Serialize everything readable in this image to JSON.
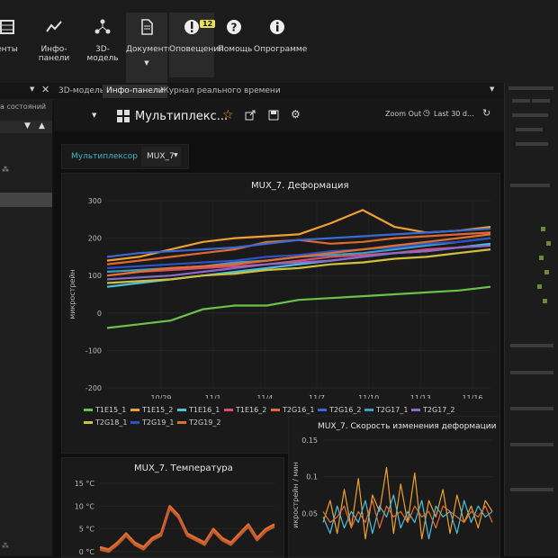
{
  "toolbar": {
    "buttons": [
      {
        "label": "енты",
        "icon": "grid-icon"
      },
      {
        "label": "Инфо-панели",
        "icon": "line-chart-icon"
      },
      {
        "label": "3D-модель",
        "icon": "network-icon"
      },
      {
        "label": "Документы",
        "icon": "document-icon"
      },
      {
        "label": "Оповещения",
        "icon": "alert-icon",
        "badge": "12"
      },
      {
        "label": "Помощь",
        "icon": "help-icon"
      },
      {
        "label": "Опрограмме",
        "icon": "info-icon"
      }
    ]
  },
  "tabs": {
    "items": [
      "3D-модель",
      "Инфо-панели",
      "Журнал реального времени"
    ],
    "active_index": 1
  },
  "left_panel": {
    "title": "а состояний"
  },
  "header": {
    "title": "Мультиплекс...",
    "zoom_out": "Zoom Out",
    "last": "Last 30 d..."
  },
  "filters": {
    "label": "Мультиплексор",
    "value": "MUX_7"
  },
  "colors": {
    "accent": "#3db7c4",
    "star": "#e8a020",
    "background": "#121212"
  },
  "chart_data": [
    {
      "type": "line",
      "title": "MUX_7. Деформация",
      "ylabel": "микрострейн",
      "ylim": [
        -200,
        300
      ],
      "yticks": [
        -200,
        -100,
        0,
        100,
        200,
        300
      ],
      "categories": [
        "10/29",
        "11/1",
        "11/4",
        "11/7",
        "11/10",
        "11/13",
        "11/16"
      ],
      "x": [
        0,
        2,
        4,
        6,
        8,
        10,
        12,
        14,
        16,
        18,
        20,
        22,
        24
      ],
      "series": [
        {
          "name": "T1E15_1",
          "color": "#6ac24a",
          "values": [
            -40,
            -30,
            -20,
            10,
            20,
            20,
            35,
            40,
            45,
            50,
            55,
            60,
            70
          ]
        },
        {
          "name": "T1E15_2",
          "color": "#f0a030",
          "values": [
            140,
            150,
            170,
            190,
            200,
            205,
            210,
            240,
            275,
            230,
            215,
            220,
            230
          ]
        },
        {
          "name": "T1E16_1",
          "color": "#4ac0e0",
          "values": [
            70,
            80,
            90,
            100,
            110,
            120,
            130,
            140,
            150,
            160,
            165,
            175,
            185
          ]
        },
        {
          "name": "T1E16_2",
          "color": "#e04a6a",
          "values": [
            100,
            110,
            115,
            120,
            125,
            130,
            140,
            150,
            155,
            160,
            170,
            175,
            180
          ]
        },
        {
          "name": "T2G16_1",
          "color": "#e06a30",
          "values": [
            130,
            140,
            150,
            160,
            170,
            190,
            195,
            185,
            190,
            200,
            205,
            210,
            215
          ]
        },
        {
          "name": "T2G16_2",
          "color": "#3a6ad8",
          "values": [
            150,
            160,
            165,
            170,
            175,
            185,
            195,
            200,
            205,
            210,
            215,
            220,
            225
          ]
        },
        {
          "name": "T2G17_1",
          "color": "#3aa0c8",
          "values": [
            110,
            115,
            120,
            125,
            135,
            140,
            150,
            155,
            160,
            170,
            180,
            190,
            200
          ]
        },
        {
          "name": "T2G17_2",
          "color": "#8a6ad0",
          "values": [
            90,
            95,
            100,
            110,
            120,
            130,
            135,
            140,
            150,
            160,
            165,
            175,
            180
          ]
        },
        {
          "name": "T2G18_1",
          "color": "#d0c040",
          "values": [
            80,
            85,
            90,
            100,
            105,
            115,
            120,
            130,
            135,
            145,
            150,
            160,
            170
          ]
        },
        {
          "name": "T2G19_1",
          "color": "#3050c8",
          "values": [
            120,
            125,
            130,
            135,
            140,
            150,
            155,
            165,
            170,
            175,
            185,
            190,
            200
          ]
        },
        {
          "name": "T2G19_2",
          "color": "#e07030",
          "values": [
            100,
            110,
            120,
            125,
            130,
            140,
            150,
            160,
            170,
            180,
            190,
            200,
            210
          ]
        }
      ],
      "legend": [
        "T1E15_1",
        "T1E15_2",
        "T1E16_1",
        "T1E16_2",
        "T2G16_1",
        "T2G16_2",
        "T2G17_1",
        "T2G17_2",
        "T2G18_1",
        "T2G19_1",
        "T2G19_2"
      ],
      "legend_position": "bottom"
    },
    {
      "type": "line",
      "title": "MUX_7. Температура",
      "yticks_labels": [
        "0 °C",
        "5 °C",
        "10 °C",
        "15 °C"
      ],
      "ylim": [
        0,
        15
      ],
      "x": [
        0,
        1,
        2,
        3,
        4,
        5,
        6,
        7,
        8,
        9,
        10,
        11,
        12,
        13,
        14,
        15,
        16,
        17,
        18,
        19,
        20
      ],
      "series": [
        {
          "name": "T1E15_1",
          "color": "#e07030",
          "values": [
            1,
            0.5,
            2,
            4,
            2,
            1,
            3,
            4,
            10,
            8,
            4,
            3,
            2,
            5,
            3,
            2,
            4,
            6,
            3,
            5,
            6
          ]
        },
        {
          "name": "T1E15_2",
          "color": "#c05a30",
          "values": [
            0.5,
            0,
            1.5,
            3.5,
            1.5,
            0.5,
            2.5,
            3.5,
            9.5,
            7.5,
            3.5,
            2.5,
            1.5,
            4.5,
            2.5,
            1.5,
            3.5,
            5.5,
            2.5,
            4.5,
            5.5
          ]
        }
      ]
    },
    {
      "type": "line",
      "title": "MUX_7. Скорость изменения деформации",
      "ylabel": "икрострейн / мин",
      "yticks_labels": [
        "0.15",
        "0.1",
        "0.05"
      ],
      "ylim": [
        -0.05,
        0.15
      ],
      "x": [
        0,
        1,
        2,
        3,
        4,
        5,
        6,
        7,
        8,
        9,
        10,
        11,
        12,
        13,
        14,
        15,
        16,
        17,
        18,
        19,
        20,
        21,
        22,
        23,
        24
      ],
      "series": [
        {
          "name": "T1E15_2",
          "color": "#f0a030",
          "values": [
            0.0,
            0.04,
            -0.02,
            0.06,
            -0.01,
            0.08,
            -0.03,
            0.05,
            0.02,
            0.1,
            -0.02,
            0.07,
            0.0,
            0.09,
            -0.03,
            0.04,
            0.01,
            0.06,
            -0.02,
            0.05,
            0.0,
            0.03,
            -0.01,
            0.04,
            0.02
          ]
        },
        {
          "name": "T1E16_1",
          "color": "#4ac0e0",
          "values": [
            0.01,
            -0.02,
            0.03,
            -0.01,
            0.02,
            0.0,
            0.04,
            -0.02,
            0.03,
            0.01,
            0.05,
            -0.01,
            0.02,
            0.0,
            0.04,
            -0.03,
            0.03,
            0.01,
            0.02,
            -0.02,
            0.04,
            0.0,
            0.03,
            0.01,
            0.02
          ]
        },
        {
          "name": "T2G19_2",
          "color": "#e07030",
          "values": [
            0.02,
            0.0,
            0.01,
            0.03,
            -0.01,
            0.02,
            0.0,
            0.04,
            -0.01,
            0.03,
            0.01,
            0.02,
            0.0,
            0.03,
            0.01,
            0.02,
            -0.01,
            0.03,
            0.02,
            0.01,
            0.0,
            0.02,
            0.01,
            0.03,
            0.0
          ]
        }
      ]
    }
  ]
}
